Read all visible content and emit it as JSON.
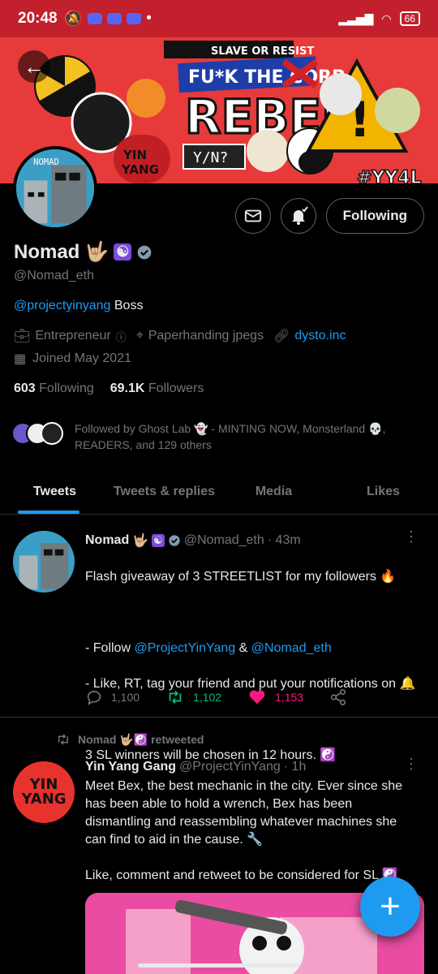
{
  "status_bar": {
    "time": "20:48",
    "battery": "66"
  },
  "profile": {
    "name": "Nomad",
    "handle": "@Nomad_eth",
    "bio_mention": "@projectyinyang",
    "bio_text": " Boss",
    "occupation": "Entrepreneur",
    "location": "Paperhanding jpegs",
    "website": "dysto.inc",
    "joined": "Joined May 2021",
    "following_count": "603",
    "following_label": "Following",
    "followers_count": "69.1K",
    "followers_label": "Followers",
    "follow_button": "Following",
    "followed_by": "Followed by Ghost Lab 👻 - MINTING NOW, Monsterland 💀, READERS, and 129 others"
  },
  "banner": {
    "tag1": "SLAVE OR RESIST",
    "tag2": "FU*K THE CORP",
    "tag3": "REBEL",
    "tag4": "Y/N?",
    "tag5": "#YY4L",
    "logo_line1": "YIN",
    "logo_line2": "YANG"
  },
  "tabs": [
    "Tweets",
    "Tweets & replies",
    "Media",
    "Likes"
  ],
  "tweets": [
    {
      "name": "Nomad",
      "handle": "@Nomad_eth",
      "time": "· 43m",
      "avatar_label": "NOMAD",
      "text_line1": "Flash giveaway of 3 STREETLIST for my followers 🔥",
      "follow_prefix": "- Follow ",
      "mention1": "@ProjectYinYang",
      "amp": " & ",
      "mention2": "@Nomad_eth",
      "text_line2": "- Like, RT, tag your friend and put your notifications on 🔔",
      "text_line3": "3 SL winners will be chosen in 12 hours. ☯️",
      "replies": "1,100",
      "retweets": "1,102",
      "likes": "1,153"
    },
    {
      "retweeted_by": "Nomad 🤟🏼☯️ retweeted",
      "name": "Yin Yang Gang",
      "handle": "@ProjectYinYang",
      "time": "· 1h",
      "avatar_line1": "YIN",
      "avatar_line2": "YANG",
      "text": "Meet Bex, the best mechanic in the city. Ever since she has been able to hold a wrench, Bex has been dismantling and reassembling whatever machines she can find to aid in the cause. 🔧\n\nLike, comment and retweet to be considered for SL ☯️"
    }
  ],
  "colors": {
    "accent": "#1d9bf0",
    "retweet": "#00ba7c",
    "like": "#f91880",
    "banner": "#e63b3a"
  }
}
